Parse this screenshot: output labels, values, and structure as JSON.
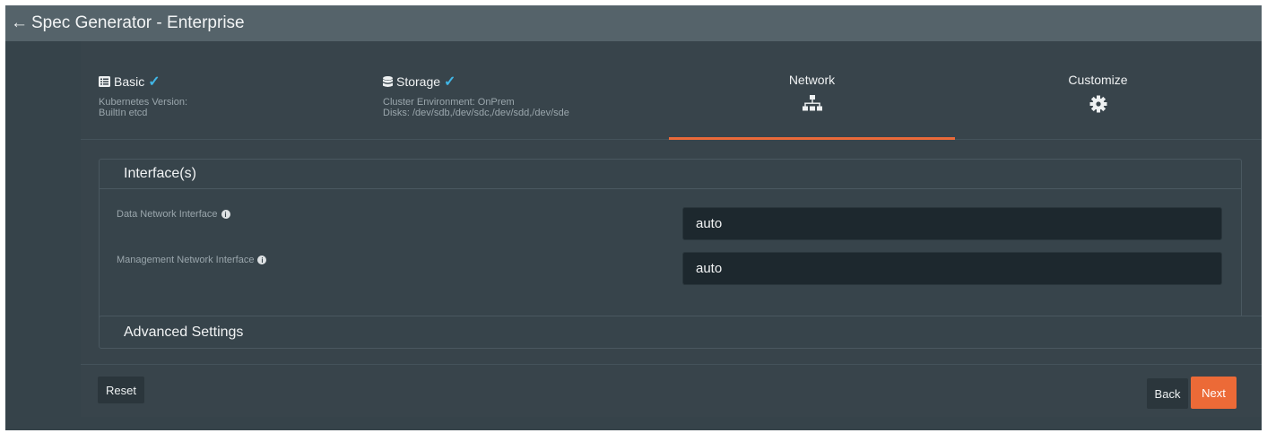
{
  "window": {
    "title": "Spec Generator - Enterprise",
    "back_arrow": "←"
  },
  "steps": [
    {
      "label": "Basic",
      "icon": "list-icon",
      "complete": true,
      "lines": [
        "Kubernetes Version:",
        "BuiltIn etcd"
      ]
    },
    {
      "label": "Storage",
      "icon": "database-icon",
      "complete": true,
      "lines": [
        "Cluster Environment: OnPrem",
        "Disks: /dev/sdb,/dev/sdc,/dev/sdd,/dev/sde"
      ]
    },
    {
      "label": "Network",
      "icon": "network-icon",
      "active": true
    },
    {
      "label": "Customize",
      "icon": "gear-icon"
    }
  ],
  "interfaces": {
    "title": "Interface(s)",
    "data_label": "Data Network Interface",
    "data_value": "auto",
    "mgmt_label": "Management Network Interface",
    "mgmt_value": "auto"
  },
  "advanced": {
    "title": "Advanced Settings"
  },
  "buttons": {
    "reset": "Reset",
    "back": "Back",
    "next": "Next"
  },
  "colors": {
    "accent": "#ec6a37",
    "check": "#41b6e6",
    "background": "#36434a"
  }
}
